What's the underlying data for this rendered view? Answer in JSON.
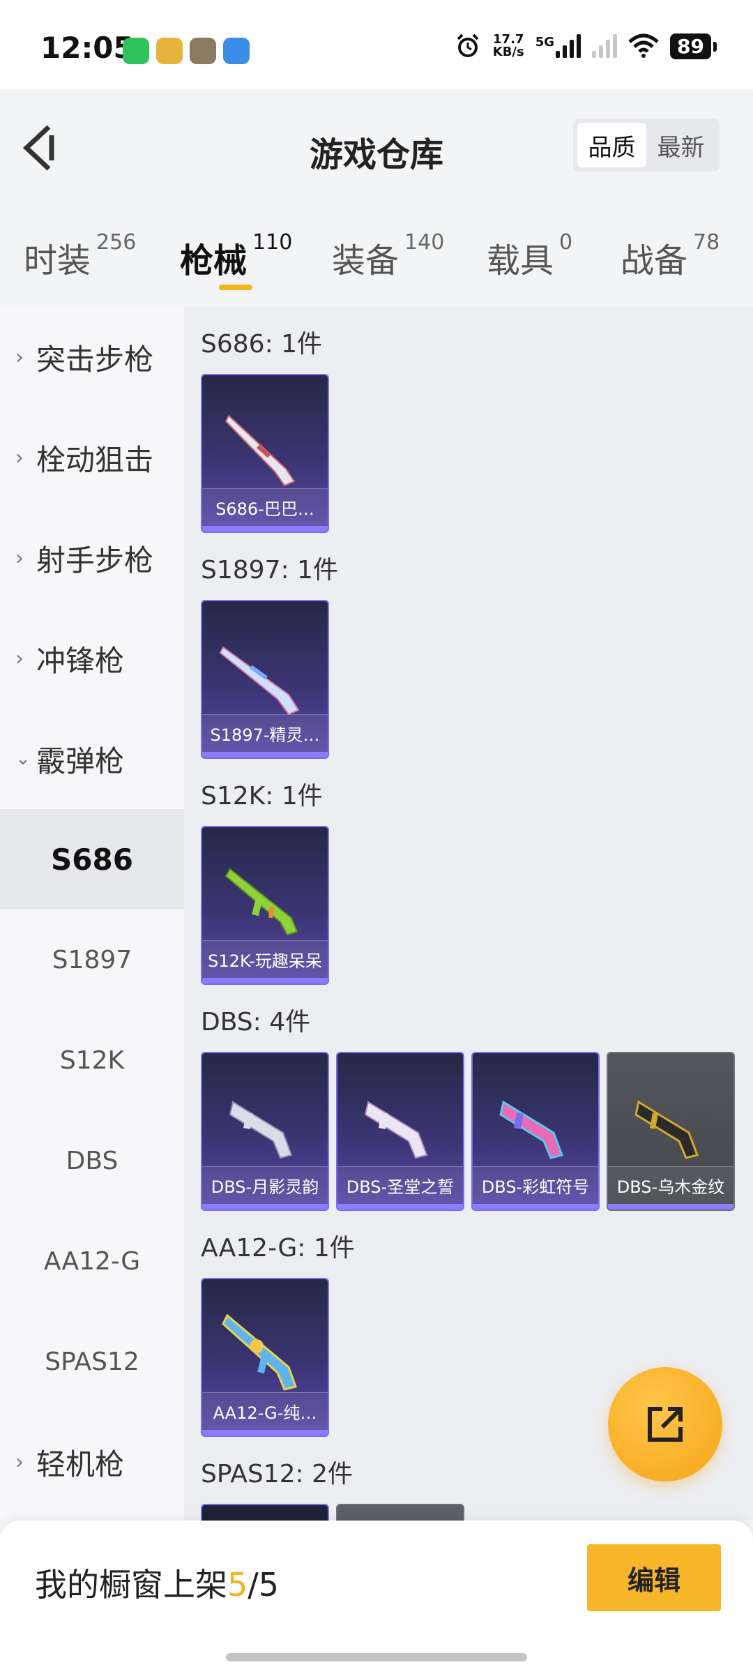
{
  "status_bar": {
    "time": "12:05",
    "net_speed_value": "17.7",
    "net_speed_unit": "KB/s",
    "network_type": "5G",
    "battery": "89",
    "app_icons": [
      "wechat-icon",
      "game-icon",
      "game2-icon",
      "app-icon"
    ]
  },
  "header": {
    "title": "游戏仓库",
    "sort_options": [
      "品质",
      "最新"
    ],
    "active_sort": "品质"
  },
  "category_tabs": [
    {
      "name": "时装",
      "count": "256"
    },
    {
      "name": "枪械",
      "count": "110"
    },
    {
      "name": "装备",
      "count": "140"
    },
    {
      "name": "载具",
      "count": "0"
    },
    {
      "name": "战备",
      "count": "78"
    }
  ],
  "active_category": "枪械",
  "sidebar": [
    {
      "label": "突击步枪",
      "type": "group",
      "expanded": false
    },
    {
      "label": "栓动狙击",
      "type": "group",
      "expanded": false
    },
    {
      "label": "射手步枪",
      "type": "group",
      "expanded": false
    },
    {
      "label": "冲锋枪",
      "type": "group",
      "expanded": false
    },
    {
      "label": "霰弹枪",
      "type": "group",
      "expanded": true
    },
    {
      "label": "S686",
      "type": "sub",
      "active": true
    },
    {
      "label": "S1897",
      "type": "sub"
    },
    {
      "label": "S12K",
      "type": "sub"
    },
    {
      "label": "DBS",
      "type": "sub"
    },
    {
      "label": "AA12-G",
      "type": "sub"
    },
    {
      "label": "SPAS12",
      "type": "sub"
    },
    {
      "label": "轻机枪",
      "type": "group",
      "expanded": false
    }
  ],
  "sections": [
    {
      "title": "S686: 1件",
      "items": [
        {
          "name": "S686-巴巴…",
          "style": "purple",
          "gun_color": "#e9e6f0"
        }
      ]
    },
    {
      "title": "S1897: 1件",
      "items": [
        {
          "name": "S1897-精灵…",
          "style": "purple",
          "gun_color": "#cfe0ff"
        }
      ]
    },
    {
      "title": "S12K: 1件",
      "items": [
        {
          "name": "S12K-玩趣呆呆",
          "style": "purple",
          "gun_color": "#8fd13b"
        }
      ]
    },
    {
      "title": "DBS: 4件",
      "items": [
        {
          "name": "DBS-月影灵韵",
          "style": "purple",
          "gun_color": "#d8dde8"
        },
        {
          "name": "DBS-圣堂之誓",
          "style": "purple",
          "gun_color": "#ece6f2"
        },
        {
          "name": "DBS-彩虹符号",
          "style": "purple",
          "gun_color": "#e86bb8"
        },
        {
          "name": "DBS-乌木金纹",
          "style": "gray",
          "gun_color": "#d4a82a"
        }
      ]
    },
    {
      "title": "AA12-G: 1件",
      "items": [
        {
          "name": "AA12-G-纯…",
          "style": "purple",
          "gun_color": "#5fb4f0"
        }
      ]
    },
    {
      "title": "SPAS12: 2件",
      "items": [
        {
          "name": "",
          "style": "purple"
        },
        {
          "name": "",
          "style": "gray"
        }
      ]
    }
  ],
  "bottom_bar": {
    "showcase_prefix": "我的橱窗上架",
    "showcase_current": "5",
    "showcase_sep": "/",
    "showcase_total": "5",
    "edit_label": "编辑"
  },
  "colors": {
    "accent": "#f5b320",
    "card_border": "#7b6cf0"
  }
}
